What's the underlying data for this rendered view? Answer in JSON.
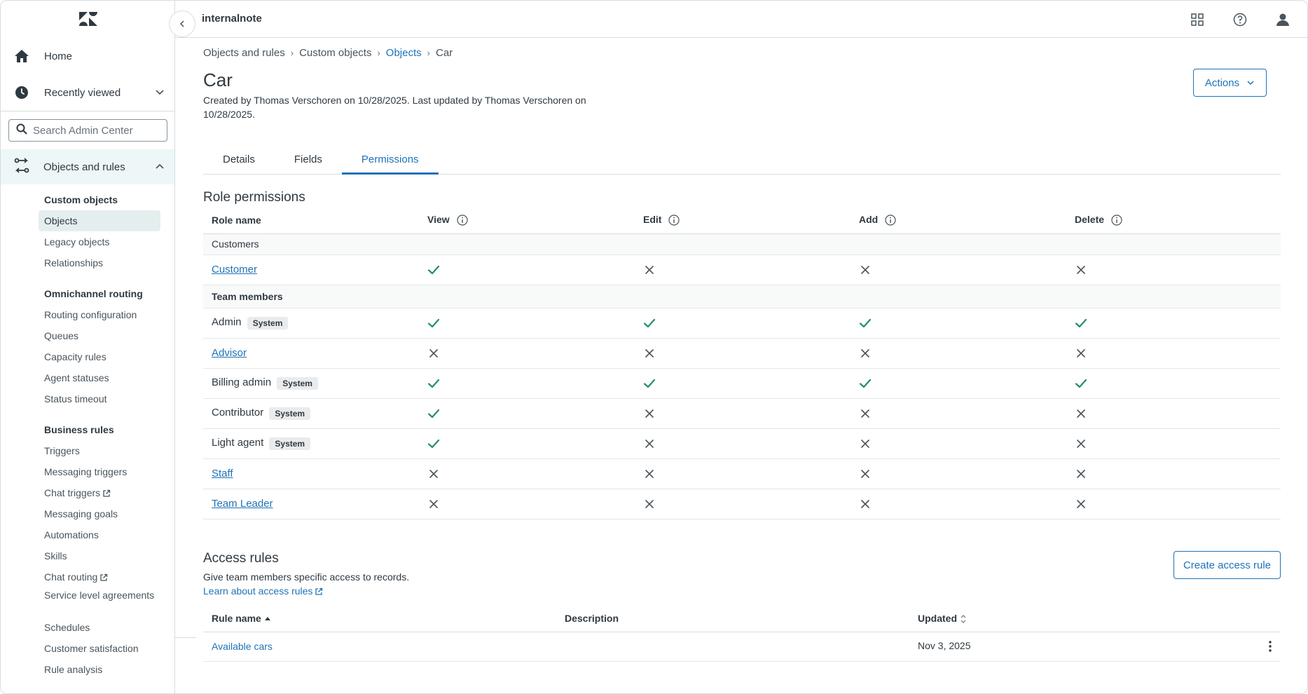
{
  "app": {
    "brand": "internalnote"
  },
  "sidebar": {
    "home": "Home",
    "recently_viewed": "Recently viewed",
    "search_placeholder": "Search Admin Center",
    "section": "Objects and rules",
    "groups": [
      {
        "heading": "Custom objects",
        "items": [
          "Objects",
          "Legacy objects",
          "Relationships"
        ]
      },
      {
        "heading": "Omnichannel routing",
        "items": [
          "Routing configuration",
          "Queues",
          "Capacity rules",
          "Agent statuses",
          "Status timeout"
        ]
      },
      {
        "heading": "Business rules",
        "items": [
          "Triggers",
          "Messaging triggers",
          "Chat triggers",
          "Messaging goals",
          "Automations",
          "Skills",
          "Chat routing",
          "Service level agreements",
          "Schedules",
          "Customer satisfaction",
          "Rule analysis"
        ]
      }
    ]
  },
  "breadcrumb": [
    "Objects and rules",
    "Custom objects",
    "Objects",
    "Car"
  ],
  "page": {
    "title": "Car",
    "meta": "Created by Thomas Verschoren on 10/28/2025. Last updated by Thomas Verschoren on 10/28/2025.",
    "actions_label": "Actions"
  },
  "tabs": [
    "Details",
    "Fields",
    "Permissions"
  ],
  "role_permissions": {
    "title": "Role permissions",
    "columns": [
      "Role name",
      "View",
      "Edit",
      "Add",
      "Delete"
    ],
    "group_customers": "Customers",
    "group_team": "Team members",
    "badge": "System",
    "customer_rows": [
      {
        "name": "Customer",
        "link": true,
        "system": false,
        "perms": [
          true,
          false,
          false,
          false
        ]
      }
    ],
    "team_rows": [
      {
        "name": "Admin",
        "link": false,
        "system": true,
        "perms": [
          true,
          true,
          true,
          true
        ]
      },
      {
        "name": "Advisor",
        "link": true,
        "system": false,
        "perms": [
          false,
          false,
          false,
          false
        ]
      },
      {
        "name": "Billing admin",
        "link": false,
        "system": true,
        "perms": [
          true,
          true,
          true,
          true
        ]
      },
      {
        "name": "Contributor",
        "link": false,
        "system": true,
        "perms": [
          true,
          false,
          false,
          false
        ]
      },
      {
        "name": "Light agent",
        "link": false,
        "system": true,
        "perms": [
          true,
          false,
          false,
          false
        ]
      },
      {
        "name": "Staff",
        "link": true,
        "system": false,
        "perms": [
          false,
          false,
          false,
          false
        ]
      },
      {
        "name": "Team Leader",
        "link": true,
        "system": false,
        "perms": [
          false,
          false,
          false,
          false
        ]
      }
    ]
  },
  "access_rules": {
    "title": "Access rules",
    "description": "Give team members specific access to records.",
    "learn_link": "Learn about access rules",
    "create_label": "Create access rule",
    "columns": [
      "Rule name",
      "Description",
      "Updated"
    ],
    "rows": [
      {
        "name": "Available cars",
        "description": "",
        "updated": "Nov 3, 2025"
      }
    ]
  },
  "colors": {
    "accent": "#1f73b7",
    "check": "#228f67",
    "cross": "#49545c",
    "active_bg": "#edf7f7"
  }
}
